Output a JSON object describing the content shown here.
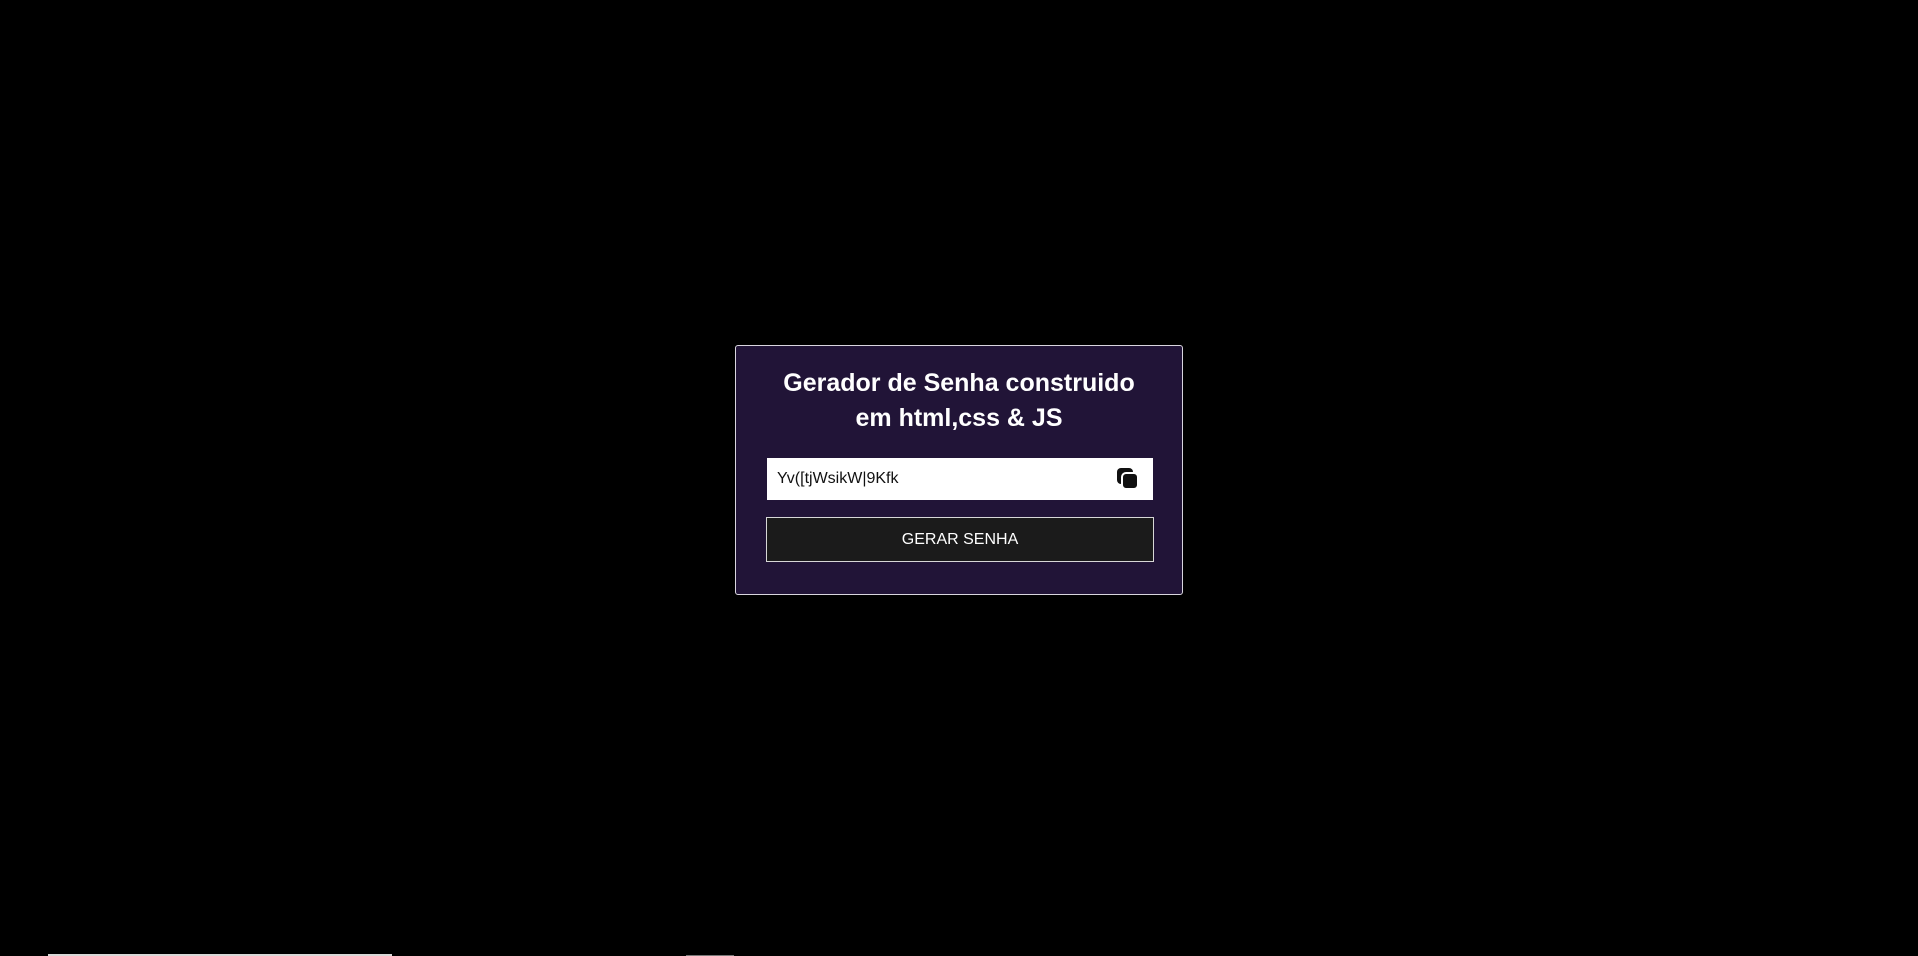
{
  "app": {
    "title": "Gerador de Senha construido\nem html,css & JS"
  },
  "password": {
    "value": "Yv([tjWsikW|9Kfk",
    "copy_icon": "copy-icon"
  },
  "actions": {
    "generate_label": "GERAR SENHA"
  },
  "colors": {
    "background": "#000000",
    "card": "#211437",
    "card_border": "#d9d6df",
    "button": "#1b1b1b",
    "text": "#ffffff"
  }
}
